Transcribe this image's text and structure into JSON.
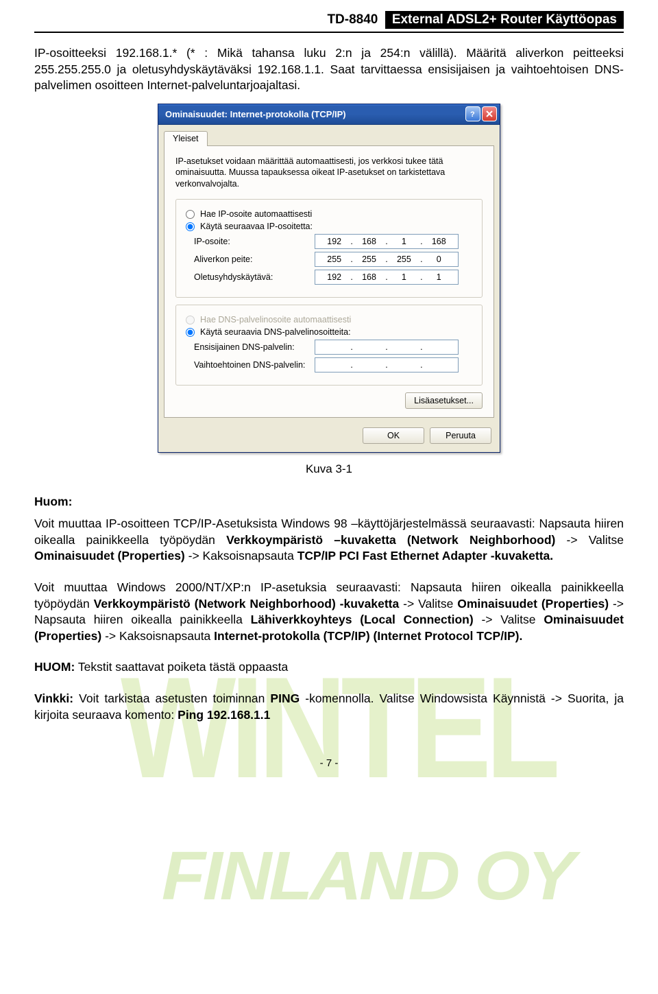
{
  "header": {
    "model": "TD-8840",
    "title": "External ADSL2+ Router Käyttöopas"
  },
  "intro_para": "IP-osoitteeksi 192.168.1.* (* : Mikä tahansa luku 2:n ja 254:n välillä). Määritä aliverkon peitteeksi 255.255.255.0 ja oletusyhdyskäytäväksi 192.168.1.1. Saat tarvittaessa ensisijaisen ja vaihtoehtoisen DNS-palvelimen osoitteen Internet-palveluntarjoajaltasi.",
  "dialog": {
    "title": "Ominaisuudet: Internet-protokolla (TCP/IP)",
    "tab": "Yleiset",
    "intro": "IP-asetukset voidaan määrittää automaattisesti, jos verkkosi tukee tätä ominaisuutta. Muussa tapauksessa oikeat IP-asetukset on tarkistettava verkonvalvojalta.",
    "radio_auto_ip": "Hae IP-osoite automaattisesti",
    "radio_manual_ip": "Käytä seuraavaa IP-osoitetta:",
    "lbl_ip": "IP-osoite:",
    "lbl_mask": "Aliverkon peite:",
    "lbl_gw": "Oletusyhdyskäytävä:",
    "ip": {
      "o1": "192",
      "o2": "168",
      "o3": "1",
      "o4": "168"
    },
    "mask": {
      "o1": "255",
      "o2": "255",
      "o3": "255",
      "o4": "0"
    },
    "gw": {
      "o1": "192",
      "o2": "168",
      "o3": "1",
      "o4": "1"
    },
    "radio_auto_dns": "Hae DNS-palvelinosoite automaattisesti",
    "radio_manual_dns": "Käytä seuraavia DNS-palvelinosoitteita:",
    "lbl_dns1": "Ensisijainen DNS-palvelin:",
    "lbl_dns2": "Vaihtoehtoinen DNS-palvelin:",
    "btn_advanced": "Lisäasetukset...",
    "btn_ok": "OK",
    "btn_cancel": "Peruuta"
  },
  "fig_caption": "Kuva 3-1",
  "note": {
    "heading": "Huom:",
    "p1a": "Voit muuttaa IP-osoitteen TCP/IP-Asetuksista Windows 98 –käyttöjärjestelmässä seuraavasti: Napsauta hiiren oikealla painikkeella työpöydän ",
    "p1b": "Verkkoympäristö –kuvaketta (Network Neighborhood)",
    "p1c": " -> Valitse ",
    "p1d": "Ominaisuudet (Properties)",
    "p1e": "-> Kaksoisnapsauta ",
    "p1f": "TCP/IP PCI Fast Ethernet Adapter -kuvaketta.",
    "p2a": "Voit muuttaa Windows 2000/NT/XP:n IP-asetuksia seuraavasti: Napsauta hiiren oikealla painikkeella työpöydän ",
    "p2b": "Verkkoympäristö (Network Neighborhood) -kuvaketta",
    "p2c": "-> Valitse ",
    "p2d": "Ominaisuudet (Properties)",
    "p2e": " -> Napsauta hiiren oikealla painikkeella ",
    "p2f": "Lähiverkkoyhteys (Local Connection)",
    "p2g": " -> Valitse ",
    "p2h": "Ominaisuudet (Properties)",
    "p2i": " -> Kaksoisnapsauta ",
    "p2j": "Internet-protokolla (TCP/IP) (Internet Protocol TCP/IP).",
    "p3a": "HUOM:",
    "p3b": " Tekstit saattavat poiketa tästä oppaasta",
    "p4a": "Vinkki:",
    "p4b": " Voit tarkistaa asetusten toiminnan ",
    "p4c": "PING",
    "p4d": "-komennolla. Valitse Windowsista Käynnistä -> Suorita, ja kirjoita seuraava komento: ",
    "p4e": "Ping 192.168.1.1"
  },
  "page_number": "- 7 -",
  "watermark1": "WINTEL",
  "watermark2": "FINLAND OY"
}
